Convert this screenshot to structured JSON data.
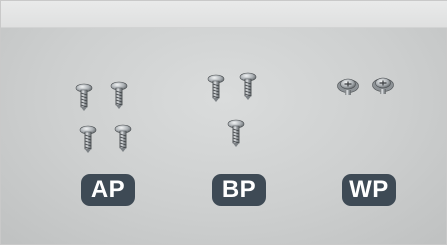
{
  "groups": [
    {
      "label": "AP",
      "screw_count": 4
    },
    {
      "label": "BP",
      "screw_count": 3
    },
    {
      "label": "WP",
      "screw_count": 2
    }
  ],
  "colors": {
    "badge_background": "#3e4a55",
    "badge_text": "#ffffff",
    "surface": "#cfd1d1"
  }
}
